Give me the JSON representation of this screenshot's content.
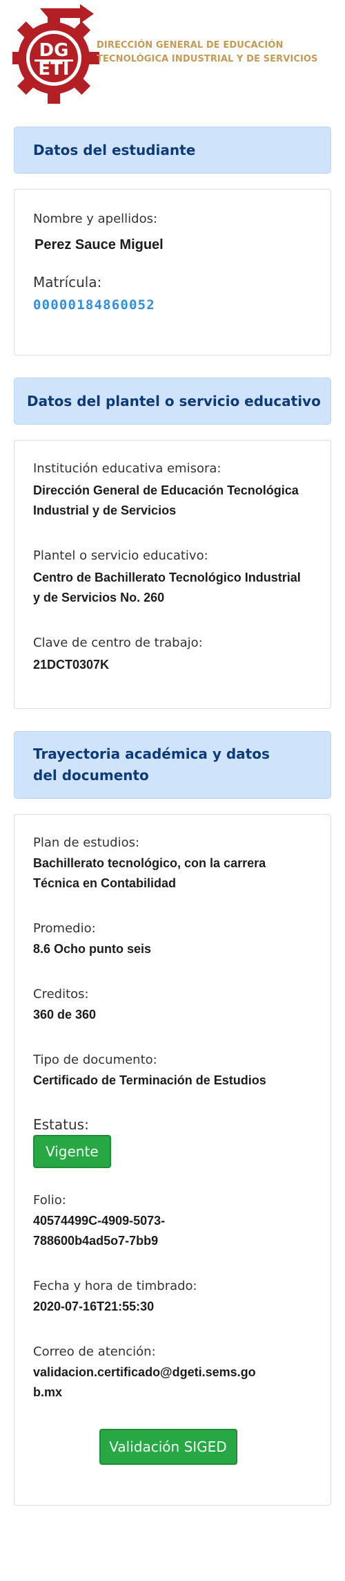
{
  "header": {
    "logo_text": "DGETI",
    "org_line1": "DIRECCIÓN GENERAL DE EDUCACIÓN",
    "org_line2": "TECNOLÓGICA INDUSTRIAL Y DE SERVICIOS",
    "logo_color": "#b31f24"
  },
  "student": {
    "title": "Datos del estudiante",
    "name_label": "Nombre y apellidos:",
    "name": "Perez Sauce Miguel",
    "matricula_label": "Matrícula:",
    "matricula": "00000184860052"
  },
  "school": {
    "title": "Datos del plantel o servicio educativo",
    "institution_label": "Institución educativa emisora:",
    "institution": "Dirección General de Educación Tecnológica Industrial y de Servicios",
    "plantel_label": "Plantel o servicio educativo:",
    "plantel": "Centro de Bachillerato Tecnológico Industrial y de Servicios No. 260",
    "clave_label": "Clave de centro de trabajo:",
    "clave": "21DCT0307K"
  },
  "academic": {
    "title": "Trayectoria académica y datos del documento",
    "plan_label": "Plan de estudios:",
    "plan": "Bachillerato tecnológico, con la carrera Técnica en Contabilidad",
    "promedio_label": "Promedio:",
    "promedio": "8.6 Ocho punto seis",
    "creditos_label": "Creditos:",
    "creditos": "360 de 360",
    "tipo_label": "Tipo de documento:",
    "tipo": "Certificado de Terminación de Estudios",
    "estatus_label": "Estatus:",
    "estatus": "Vigente",
    "folio_label": "Folio:",
    "folio_line1": "40574499C-4909-5073-",
    "folio_line2": "788600b4ad5o7-7bb9",
    "fecha_label": "Fecha y hora de timbrado:",
    "fecha": "2020-07-16T21:55:30",
    "correo_label": "Correo de atención:",
    "correo_line1": "validacion.certificado@dgeti.sems.go",
    "correo_line2": "b.mx",
    "siged_button": "Validación SIGED"
  },
  "colors": {
    "section_bg": "#cfe3fb",
    "section_text": "#0d3b78",
    "accent_blue": "#2d8ee6",
    "button_green": "#28a745",
    "org_gold": "#c49a55"
  }
}
